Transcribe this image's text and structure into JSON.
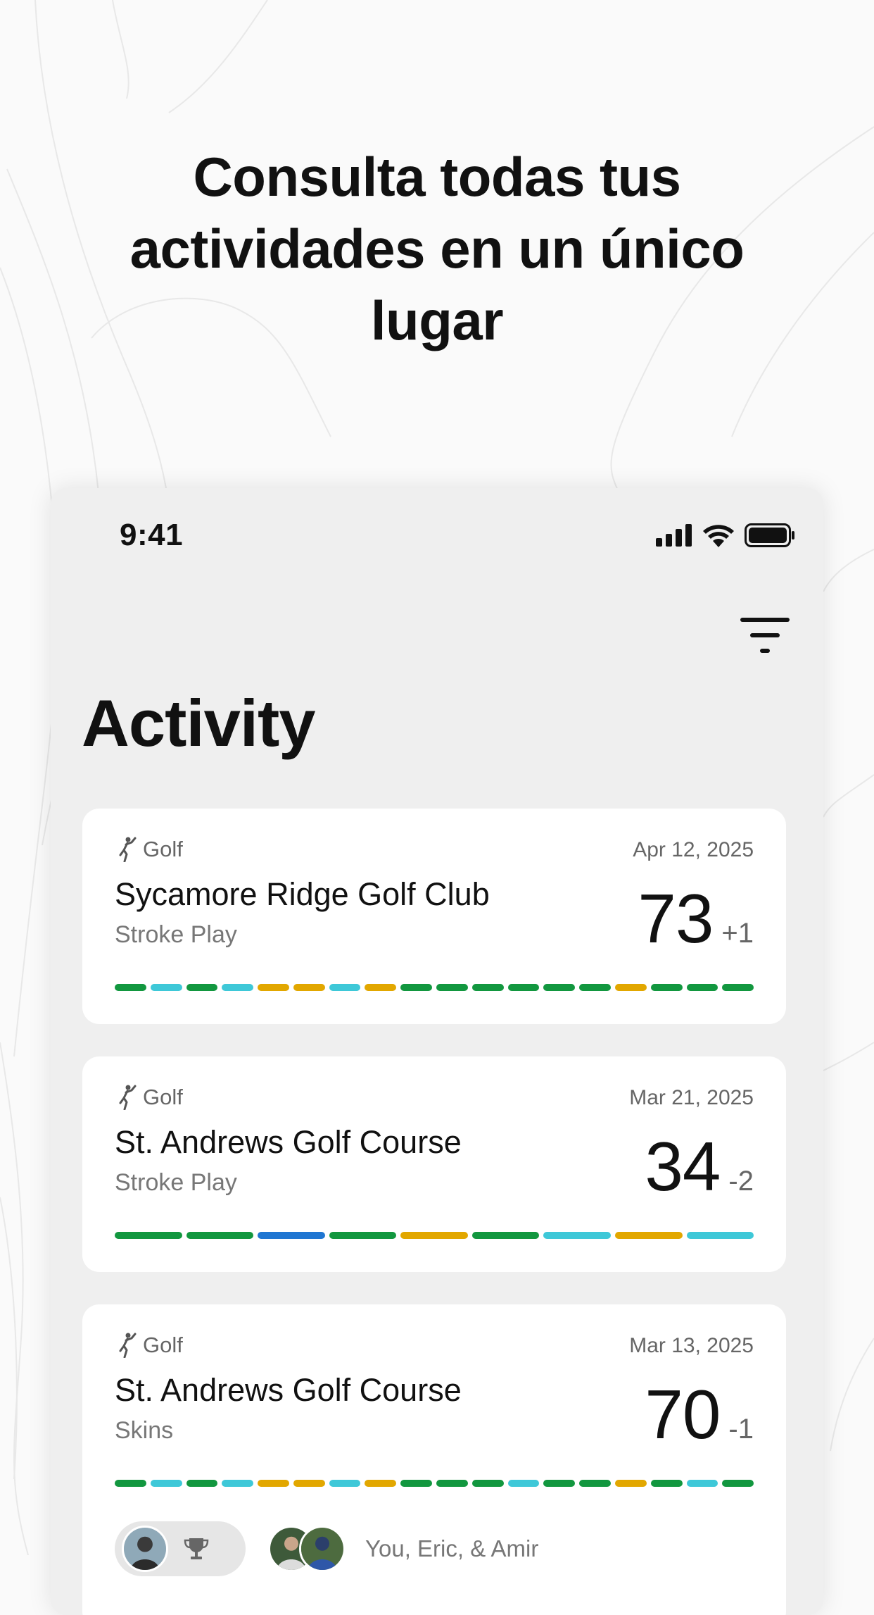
{
  "headline": "Consulta todas tus actividades en un único lugar",
  "status_bar": {
    "time": "9:41",
    "icons": [
      "signal-icon",
      "wifi-icon",
      "battery-icon"
    ]
  },
  "header": {
    "title": "Activity",
    "filter_icon": "filter-icon"
  },
  "colors": {
    "green": "#12973f",
    "teal": "#3ec8d8",
    "gold": "#e2a700",
    "blue": "#1f76d2"
  },
  "activities": [
    {
      "type": "Golf",
      "date": "Apr 12, 2025",
      "course": "Sycamore Ridge Golf Club",
      "mode": "Stroke Play",
      "score": "73",
      "diff": "+1",
      "holes": [
        "green",
        "teal",
        "green",
        "teal",
        "gold",
        "gold",
        "teal",
        "gold",
        "green",
        "green",
        "green",
        "green",
        "green",
        "green",
        "gold",
        "green",
        "green",
        "green"
      ]
    },
    {
      "type": "Golf",
      "date": "Mar 21, 2025",
      "course": "St. Andrews Golf Course",
      "mode": "Stroke Play",
      "score": "34",
      "diff": "-2",
      "holes": [
        "green",
        "green",
        "blue",
        "green",
        "gold",
        "green",
        "teal",
        "gold",
        "teal"
      ]
    },
    {
      "type": "Golf",
      "date": "Mar 13, 2025",
      "course": "St. Andrews Golf Course",
      "mode": "Skins",
      "score": "70",
      "diff": "-1",
      "holes": [
        "green",
        "teal",
        "green",
        "teal",
        "gold",
        "gold",
        "teal",
        "gold",
        "green",
        "green",
        "green",
        "teal",
        "green",
        "green",
        "gold",
        "green",
        "teal",
        "green"
      ],
      "players_text": "You, Eric, & Amir"
    }
  ]
}
